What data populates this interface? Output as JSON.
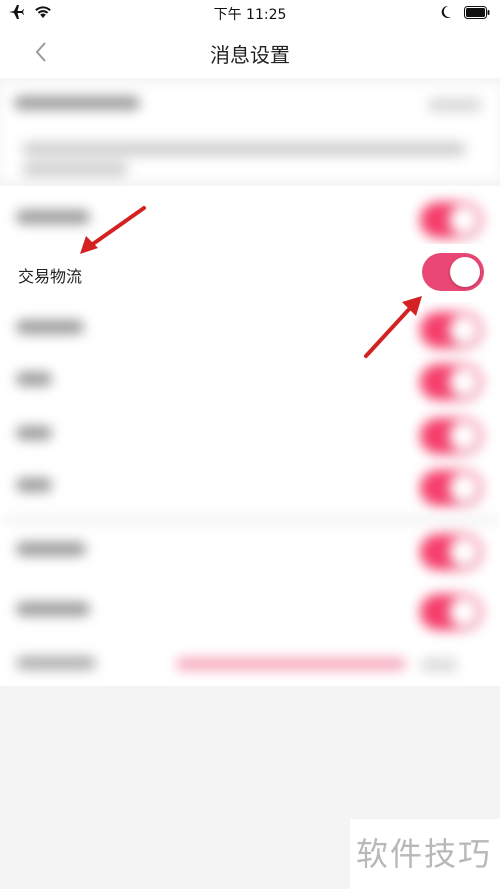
{
  "status_bar": {
    "time": "下午 11:25",
    "icons": [
      "airplane-icon",
      "wifi-icon",
      "moon-icon",
      "battery-icon"
    ]
  },
  "nav": {
    "title": "消息设置",
    "back_icon": "chevron-left-icon"
  },
  "settings": {
    "highlighted_row": {
      "label": "交易物流",
      "enabled": true
    },
    "blurred_rows_count": 8
  },
  "colors": {
    "toggle_on": "#f53e6a",
    "arrow": "#d42121"
  },
  "watermark": {
    "text": "软件技巧"
  }
}
